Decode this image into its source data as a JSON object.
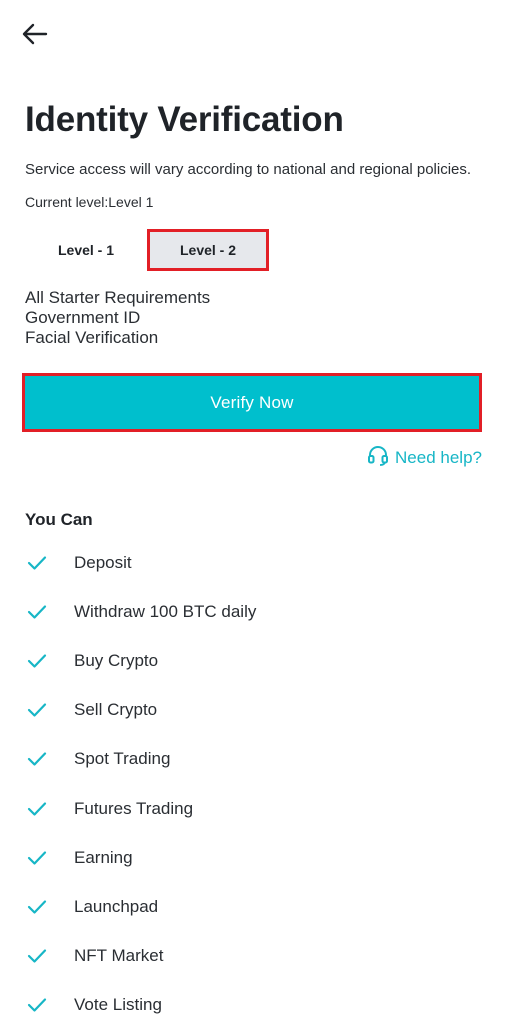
{
  "header": {
    "back_icon": "arrow-left-icon"
  },
  "page": {
    "title": "Identity Verification",
    "subtitle": "Service access will vary according to national and regional policies.",
    "current_level": "Current level:Level 1"
  },
  "levels": [
    {
      "label": "Level - 1",
      "selected": false
    },
    {
      "label": "Level - 2",
      "selected": true
    }
  ],
  "requirements": [
    "All Starter Requirements",
    "Government ID",
    "Facial Verification"
  ],
  "actions": {
    "verify_label": "Verify Now",
    "help_label": "Need help?",
    "help_icon": "headset-icon"
  },
  "you_can": {
    "title": "You Can",
    "check_icon": "check-icon",
    "items": [
      "Deposit",
      "Withdraw 100 BTC daily",
      "Buy Crypto",
      "Sell Crypto",
      "Spot Trading",
      "Futures Trading",
      "Earning",
      "Launchpad",
      "NFT Market",
      "Vote Listing"
    ]
  },
  "colors": {
    "accent": "#00bfcd",
    "accent_text": "#17b6c6",
    "highlight_border": "#e21f26",
    "selected_tab_bg": "#e6e8ec",
    "text_primary": "#1f2328"
  }
}
